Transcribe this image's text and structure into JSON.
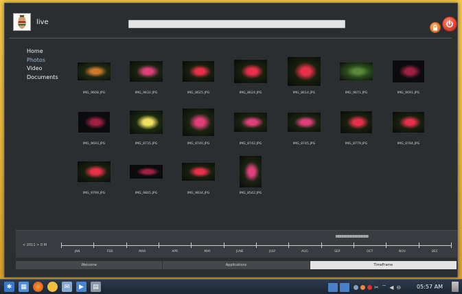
{
  "user": {
    "name": "live"
  },
  "search": {
    "value": ""
  },
  "nav": {
    "items": [
      {
        "label": "Home"
      },
      {
        "label": "Photos",
        "active": true
      },
      {
        "label": "Video"
      },
      {
        "label": "Documents"
      }
    ]
  },
  "photos": [
    {
      "name": "IMG_9608.JPG",
      "icon": "photo-flower-orange"
    },
    {
      "name": "IMG_9632.JPG",
      "icon": "photo-flower-pink"
    },
    {
      "name": "IMG_8625.JPG",
      "icon": "photo-flower-red"
    },
    {
      "name": "IMG_8624.JPG",
      "icon": "photo-flower-red"
    },
    {
      "name": "IMG_8614.JPG",
      "icon": "photo-flower-red"
    },
    {
      "name": "IMG_9671.JPG",
      "icon": "photo-leaves"
    },
    {
      "name": "IMG_9691.JPG",
      "icon": "photo-flower-dark"
    },
    {
      "name": "IMG_9693.JPG",
      "icon": "photo-flower-dark"
    },
    {
      "name": "IMG_8735.JPG",
      "icon": "photo-butterfly"
    },
    {
      "name": "IMG_8740.JPG",
      "icon": "photo-flower-pink"
    },
    {
      "name": "IMG_8742.JPG",
      "icon": "photo-flower-pink"
    },
    {
      "name": "IMG_8745.JPG",
      "icon": "photo-flower-pink"
    },
    {
      "name": "IMG_8779.JPG",
      "icon": "photo-flower-red"
    },
    {
      "name": "IMG_8784.JPG",
      "icon": "photo-flower-red"
    },
    {
      "name": "IMG_9799.JPG",
      "icon": "photo-flower-red"
    },
    {
      "name": "IMG_9805.JPG",
      "icon": "photo-flower-dark"
    },
    {
      "name": "IMG_9834.JPG",
      "icon": "photo-flower-red"
    },
    {
      "name": "IMG_8542.JPG",
      "icon": "photo-flower-pink"
    }
  ],
  "timeline": {
    "year_label": "< 2011 >  0  M",
    "months": [
      "JAN",
      "FEB",
      "MAR",
      "APR",
      "MAY",
      "JUNE",
      "JULY",
      "AUG",
      "SEP",
      "OCT",
      "NOV",
      "DEC"
    ]
  },
  "tabs": [
    {
      "label": "Welcome"
    },
    {
      "label": "Applications"
    },
    {
      "label": "TimeFrame",
      "active": true
    }
  ],
  "taskbar": {
    "clock": "05:57 AM",
    "launchers": [
      "kde-icon",
      "files-icon",
      "firefox-icon",
      "chat-icon",
      "mail-icon",
      "media-icon",
      "terminal-icon"
    ],
    "tray_icons": [
      "folder-icon",
      "folder-icon",
      "network-icon",
      "update-icon",
      "error-icon",
      "scissors-icon",
      "wifi-icon",
      "volume-icon",
      "battery-icon"
    ]
  },
  "colors": {
    "background": "#2b2e31",
    "accent_active_nav": "#9fb6d4",
    "power": "#d23a28",
    "lock": "#e0742a"
  }
}
